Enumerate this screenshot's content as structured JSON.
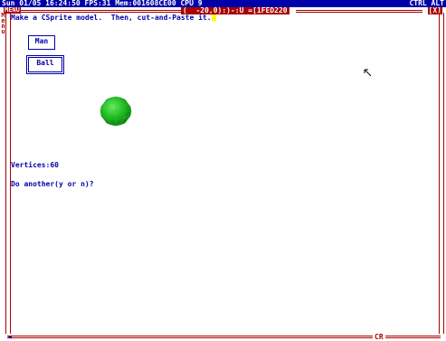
{
  "status_bar": {
    "left_text": "Sun 01/05 16:24:50 FPS:31 Mem:001608CE00 CPU 9",
    "right_text": "CTRL ALT"
  },
  "window": {
    "menu_label": "MENU",
    "cursor_info": "(  -20,0):)-:U =[1FED220",
    "close_label": "[X]",
    "side_label": [
      "M",
      "e",
      "n",
      "u"
    ]
  },
  "content": {
    "instructions": "Make a CSprite model.  Then, cut-and-Paste it.",
    "buttons": {
      "man": "Man",
      "ball": "Ball"
    },
    "console_lines": [
      "Vertices:60",
      "Do another(y or n)?"
    ]
  },
  "bottom_bar": {
    "cr_label": "CR"
  },
  "colors": {
    "blue": "#0000a8",
    "red": "#a80000",
    "green": "#22aa22",
    "yellow": "#ffff00"
  },
  "icons": {
    "sprite": "green-ball-sprite-icon",
    "pointer": "mouse-pointer-icon"
  }
}
